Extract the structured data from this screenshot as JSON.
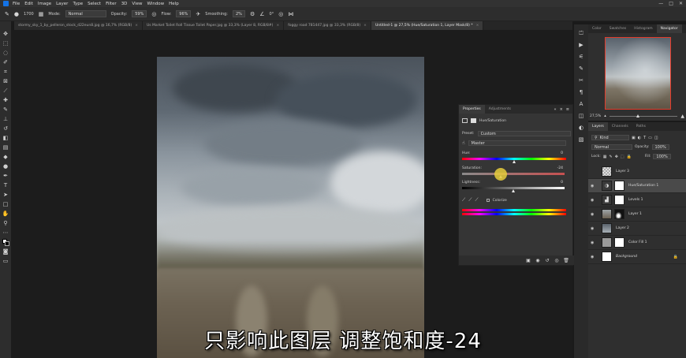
{
  "menubar": {
    "items": [
      "File",
      "Edit",
      "Image",
      "Layer",
      "Type",
      "Select",
      "Filter",
      "3D",
      "View",
      "Window",
      "Help"
    ],
    "window_controls": [
      "—",
      "□",
      "✕"
    ]
  },
  "options": {
    "brush_size": "1700",
    "mode_label": "Mode:",
    "mode_value": "Normal",
    "opacity_label": "Opacity:",
    "opacity_value": "59%",
    "flow_label": "Flow:",
    "flow_value": "96%",
    "smoothing_label": "Smoothing:",
    "smoothing_value": "2%",
    "angle_value": "0°"
  },
  "tabs": [
    {
      "label": "stormy_sky_1_by_pelleron_stock_d22eun8.jpg @ 16,7% (RGB/8)",
      "active": false
    },
    {
      "label": "Us Market Toilet Roll Tissue Toilet Paper.jpg @ 33,3% (Layer 8, RGB/8#)",
      "active": false
    },
    {
      "label": "foggy road 781447.jpg @ 33,3% (RGB/8)",
      "active": false
    },
    {
      "label": "Untitled-1 @ 27,5% (Hue/Saturation 1, Layer Mask/8) *",
      "active": true
    }
  ],
  "navigator": {
    "tabs": [
      "Color",
      "Swatches",
      "Histogram",
      "Navigator"
    ],
    "active_tab": "Navigator",
    "zoom": "27,5%",
    "zoom_fraction": 0.4
  },
  "layers": {
    "tabs": [
      "Layers",
      "Channels",
      "Paths"
    ],
    "kind_label": "Kind",
    "blend_mode": "Normal",
    "opacity_label": "Opacity:",
    "opacity_value": "100%",
    "lock_label": "Lock:",
    "fill_label": "Fill:",
    "fill_value": "100%",
    "items": [
      {
        "name": "Layer 3",
        "selected": false,
        "visible": false,
        "thumb": "#cfcfcf",
        "mask": null
      },
      {
        "name": "Hue/Saturation 1",
        "selected": true,
        "visible": true,
        "thumb": "#6e6e6e",
        "mask": "#ffffff"
      },
      {
        "name": "Levels 1",
        "selected": false,
        "visible": true,
        "thumb": "#6e6e6e",
        "mask": "#ffffff"
      },
      {
        "name": "Layer 1",
        "selected": false,
        "visible": true,
        "thumb": "#8a8a8a",
        "mask": "#111111"
      },
      {
        "name": "Layer 2",
        "selected": false,
        "visible": true,
        "thumb": "#7b828b",
        "mask": null
      },
      {
        "name": "Color Fill 1",
        "selected": false,
        "visible": true,
        "thumb": "#9a9a9a",
        "mask": "#ffffff"
      },
      {
        "name": "Background",
        "selected": false,
        "visible": true,
        "thumb": "#ffffff",
        "mask": null
      }
    ]
  },
  "properties": {
    "tabs": [
      "Properties",
      "Adjustments"
    ],
    "active_tab": "Properties",
    "adjustment_name": "Hue/Saturation",
    "preset_label": "Preset:",
    "preset_value": "Custom",
    "channel_value": "Master",
    "hue_label": "Hue:",
    "hue_value": "0",
    "hue_fraction": 0.5,
    "saturation_label": "Saturation:",
    "saturation_value": "-24",
    "saturation_fraction": 0.38,
    "lightness_label": "Lightness:",
    "lightness_value": "0",
    "lightness_fraction": 0.5,
    "colorize_label": "Colorize"
  },
  "subtitle": "只影响此图层 调整饱和度-24"
}
